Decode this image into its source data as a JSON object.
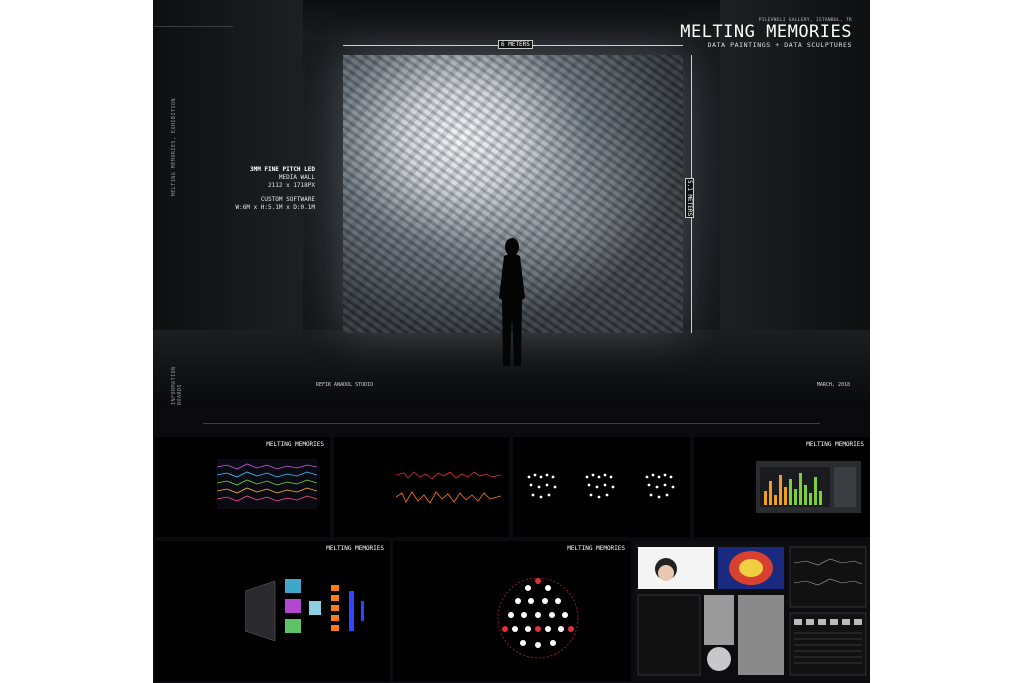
{
  "hero": {
    "venue": "PILEVNELI GALLERY, ISTANBUL, TR",
    "title": "MELTING MEMORIES",
    "subtitle": "DATA PAINTINGS + DATA SCULPTURES",
    "width_label": "6 METERS",
    "height_label": "5.1 METERS",
    "side_top": "MELTING MEMORIES, EXHIBITION",
    "side_bottom": "INFORMATION BOARDS",
    "spec_title": "3MM FINE PITCH LED",
    "spec_line2": "MEDIA WALL",
    "spec_line3": "2112 x 1718PX",
    "spec_line4": "CUSTOM SOFTWARE",
    "spec_line5": "W:6M x H:5.1M x D:0.1M",
    "studio": "REFIK ANADOL STUDIO",
    "date": "MARCH, 2018"
  },
  "panels": {
    "p1_title": "MELTING MEMORIES",
    "p4_title": "MELTING MEMORIES",
    "p5_title": "MELTING MEMORIES",
    "p6_title": "MELTING MEMORIES"
  },
  "colors": {
    "board": "#0b0b0d",
    "accent_green": "#7bd13a",
    "accent_orange": "#ff7a1a",
    "accent_blue": "#2f45ff",
    "accent_red": "#e0303a"
  },
  "icons": [
    "person-silhouette-icon",
    "led-wall-image"
  ]
}
